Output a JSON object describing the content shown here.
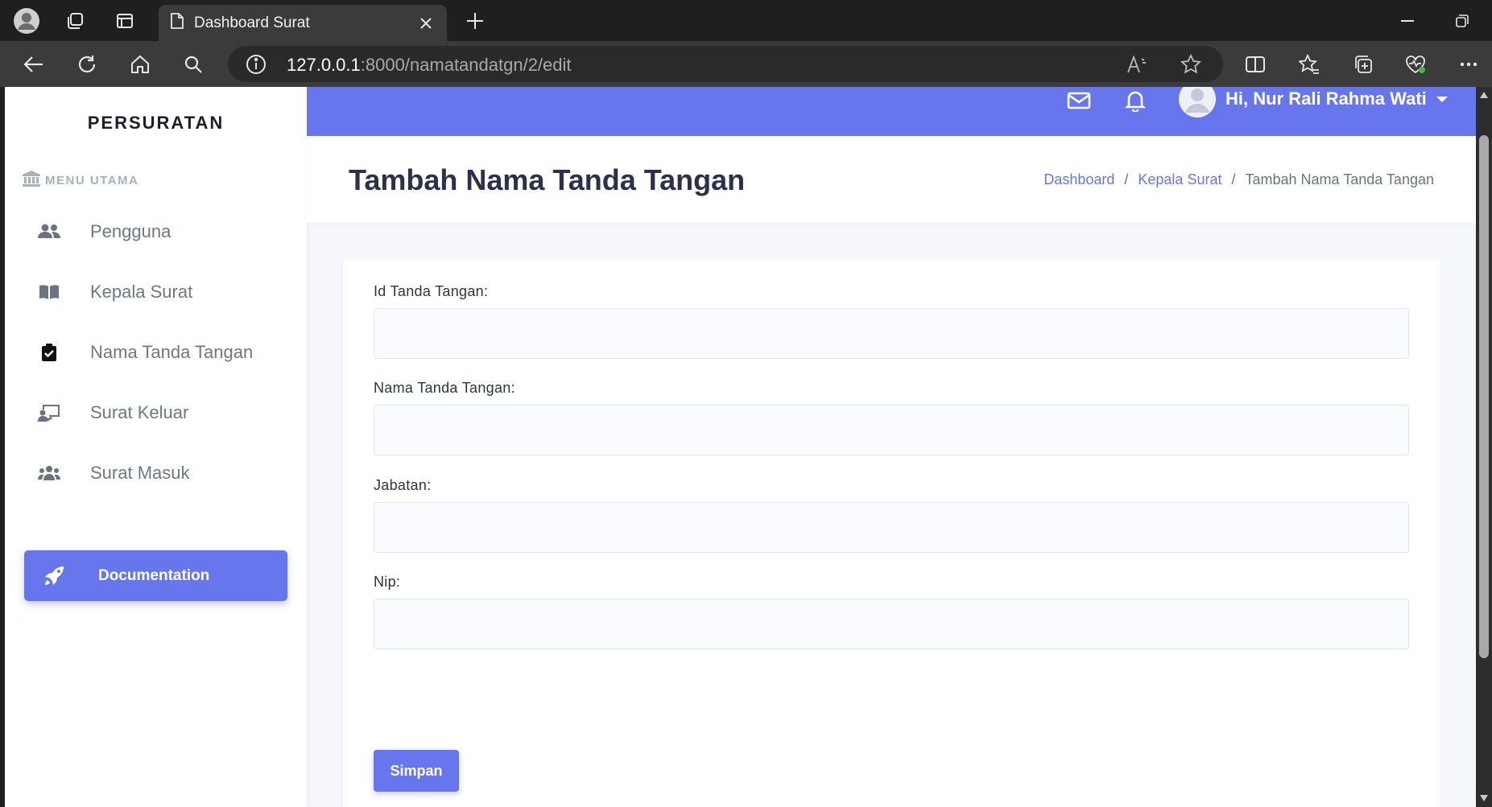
{
  "browser": {
    "tab_title": "Dashboard Surat",
    "url_host": "127.0.0.1",
    "url_rest": ":8000/namatandatgn/2/edit"
  },
  "sidebar": {
    "brand": "PERSURATAN",
    "menu_heading": "MENU UTAMA",
    "items": [
      {
        "label": "Pengguna",
        "icon": "users-icon"
      },
      {
        "label": "Kepala Surat",
        "icon": "book-icon"
      },
      {
        "label": "Nama Tanda Tangan",
        "icon": "clipboard-check-icon"
      },
      {
        "label": "Surat Keluar",
        "icon": "chalkboard-user-icon"
      },
      {
        "label": "Surat Masuk",
        "icon": "users-group-icon"
      }
    ],
    "doc_button": "Documentation"
  },
  "topbar": {
    "user_greeting": "Hi, Nur Rali Rahma Wati"
  },
  "header": {
    "title": "Tambah Nama Tanda Tangan",
    "breadcrumb": [
      "Dashboard",
      "Kepala Surat",
      "Tambah Nama Tanda Tangan"
    ]
  },
  "form": {
    "fields": [
      {
        "label": "Id Tanda Tangan:",
        "value": ""
      },
      {
        "label": "Nama Tanda Tangan:",
        "value": ""
      },
      {
        "label": "Jabatan:",
        "value": ""
      },
      {
        "label": "Nip:",
        "value": ""
      }
    ],
    "submit": "Simpan"
  },
  "colors": {
    "accent": "#6876ee",
    "chrome_dark": "#1f1f1f",
    "chrome_toolbar": "#3b3b3b"
  }
}
